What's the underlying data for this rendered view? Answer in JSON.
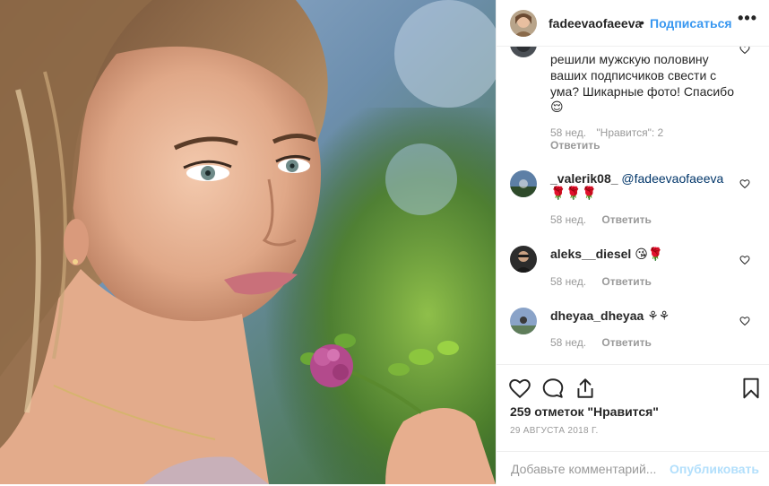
{
  "header": {
    "username": "fadeevaofaeeva",
    "dot": "•",
    "follow_label": "Подписаться",
    "more_icon": "more-horizontal-icon"
  },
  "comments": [
    {
      "text_lines": [
        "решили мужскую половину",
        "ваших подписчиков свести с",
        "ума? Шикарные фото! Спасибо",
        "😌"
      ],
      "age": "58 нед.",
      "likes": "\"Нравится\": 2",
      "reply": "Ответить"
    },
    {
      "username": "_valerik08_",
      "mention": "@fadeevaofaeeva",
      "body": "🌹🌹🌹",
      "age": "58 нед.",
      "reply": "Ответить"
    },
    {
      "username": "aleks__diesel",
      "body": "😘🌹",
      "age": "58 нед.",
      "reply": "Ответить"
    },
    {
      "username": "dheyaa_dheyaa",
      "body": "⚘⚘",
      "age": "58 нед.",
      "reply": "Ответить"
    }
  ],
  "actions": {
    "like_icon": "heart-outline-icon",
    "comment_icon": "comment-bubble-icon",
    "share_icon": "share-upload-icon",
    "save_icon": "bookmark-icon",
    "likes_text": "259 отметок \"Нравится\"",
    "date": "29 АВГУСТА 2018 Г."
  },
  "add_comment": {
    "placeholder": "Добавьте комментарий...",
    "publish_label": "Опубликовать"
  },
  "colors": {
    "link_blue": "#3897f0",
    "publish_disabled": "#b2dffc",
    "meta_grey": "#999999",
    "border": "#efefef"
  }
}
